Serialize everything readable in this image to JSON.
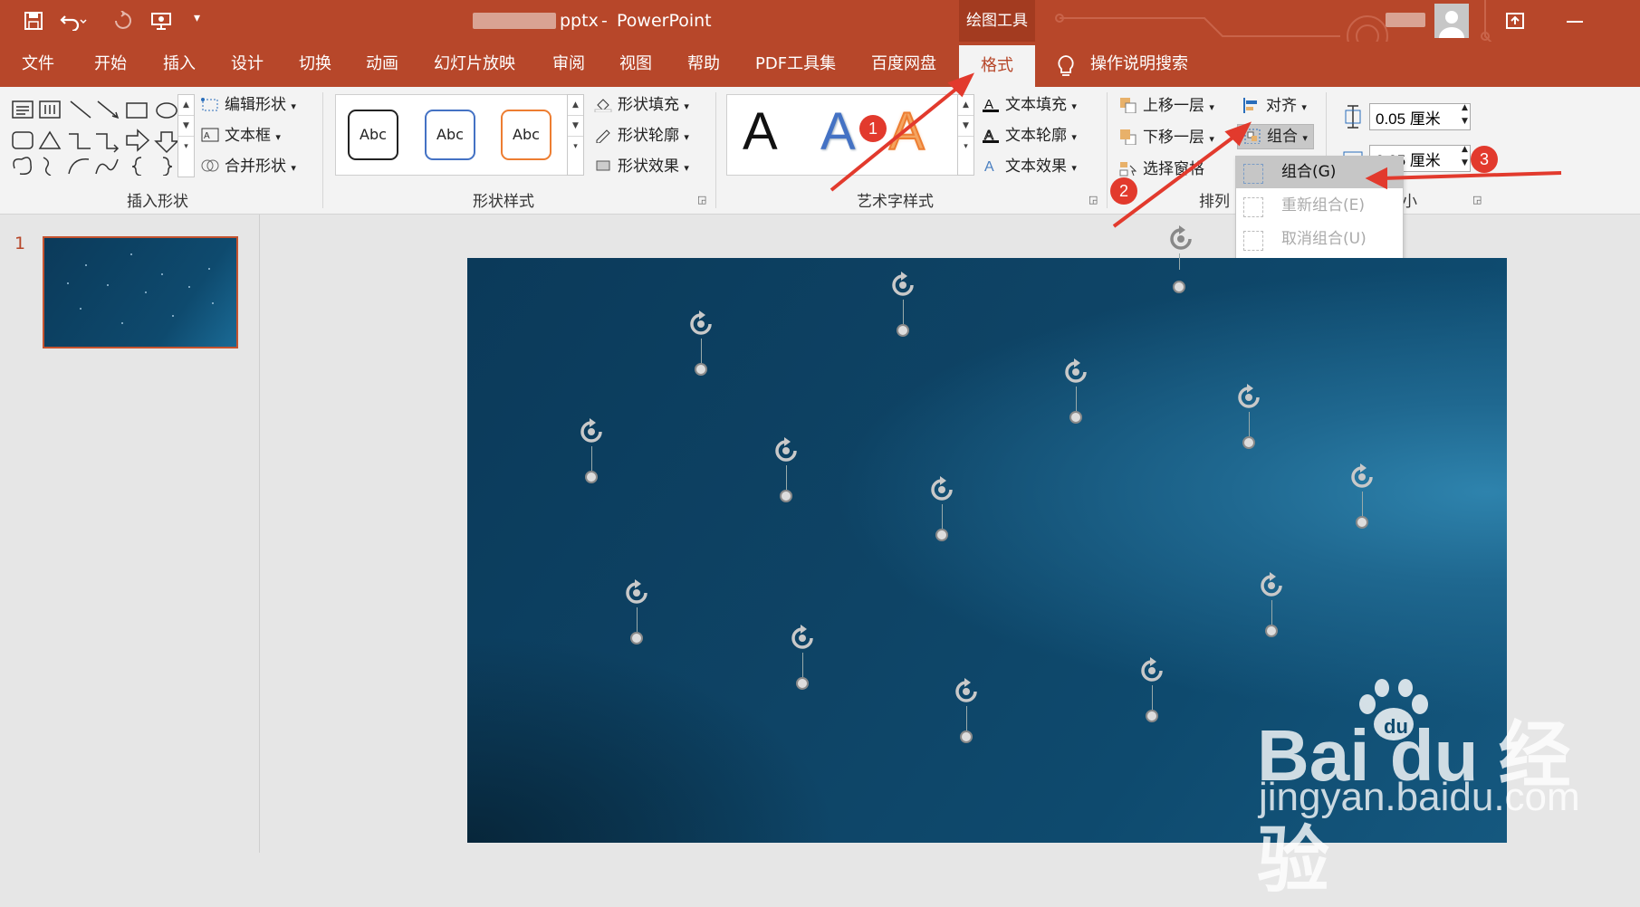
{
  "window": {
    "file_suffix": "pptx",
    "separator": "-",
    "app_name": "PowerPoint",
    "context_tab_group": "绘图工具"
  },
  "tabs": [
    "文件",
    "开始",
    "插入",
    "设计",
    "切换",
    "动画",
    "幻灯片放映",
    "审阅",
    "视图",
    "帮助",
    "PDF工具集",
    "百度网盘"
  ],
  "active_tab": "格式",
  "tell_me": "操作说明搜索",
  "ribbon": {
    "insert_shapes": {
      "label": "插入形状",
      "edit_shape": "编辑形状",
      "text_box": "文本框",
      "merge_shapes": "合并形状"
    },
    "shape_styles": {
      "label": "形状样式",
      "preset_text": "Abc",
      "presets": [
        {
          "border": "#222222"
        },
        {
          "border": "#4472c4"
        },
        {
          "border": "#ed7d31"
        }
      ],
      "fill": "形状填充",
      "outline": "形状轮廓",
      "effects": "形状效果"
    },
    "wordart_styles": {
      "label": "艺术字样式",
      "letter": "A",
      "text_fill": "文本填充",
      "text_outline": "文本轮廓",
      "text_effects": "文本效果"
    },
    "arrange": {
      "label": "排列",
      "bring_forward": "上移一层",
      "send_backward": "下移一层",
      "selection_pane": "选择窗格",
      "align": "对齐",
      "group": "组合"
    },
    "size": {
      "label": "小",
      "height_value": "0.05 厘米",
      "width_value": "0.05 厘米"
    }
  },
  "group_menu": {
    "items": [
      {
        "label": "组合(G)",
        "enabled": true
      },
      {
        "label": "重新组合(E)",
        "enabled": false
      },
      {
        "label": "取消组合(U)",
        "enabled": false
      }
    ]
  },
  "slides": {
    "thumbnail_number": "1"
  },
  "annotations": {
    "badges": [
      "1",
      "2",
      "3"
    ],
    "color": "#e23a2d"
  },
  "watermark": {
    "brand": "Bai  du 经验",
    "url": "jingyan.baidu.com"
  },
  "colors": {
    "accent": "#b7472a",
    "slide_bg": "#0e4466"
  }
}
